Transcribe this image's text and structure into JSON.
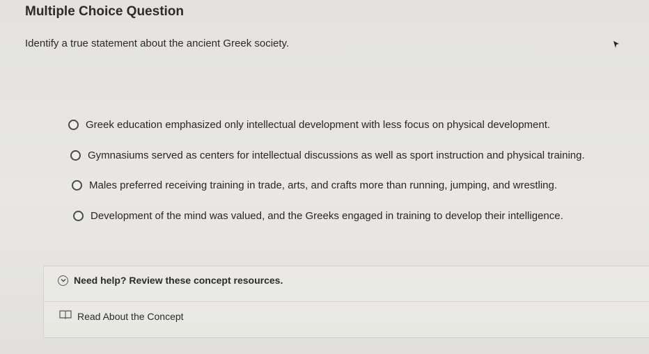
{
  "question": {
    "heading": "Multiple Choice Question",
    "prompt": "Identify a true statement about the ancient Greek society."
  },
  "options": [
    {
      "label": "Greek education emphasized only intellectual development with less focus on physical development.",
      "selected": false
    },
    {
      "label": "Gymnasiums served as centers for intellectual discussions as well as sport instruction and physical training.",
      "selected": false
    },
    {
      "label": "Males preferred receiving training in trade, arts, and crafts more than running, jumping, and wrestling.",
      "selected": false
    },
    {
      "label": "Development of the mind was valued, and the Greeks engaged in training to develop their intelligence.",
      "selected": false
    }
  ],
  "help": {
    "toggle_label": "Need help? Review these concept resources.",
    "toggle_icon": "chevron-down-icon",
    "resource_label": "Read About the Concept",
    "resource_icon": "book-icon"
  }
}
